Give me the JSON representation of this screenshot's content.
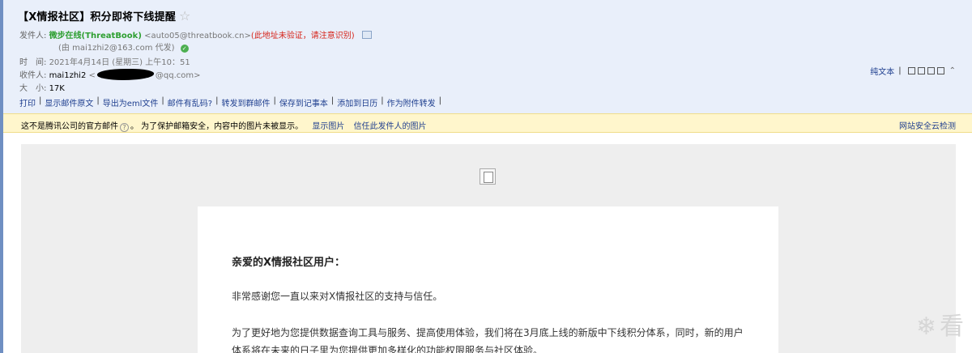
{
  "email": {
    "subject": "【X情报社区】积分即将下线提醒",
    "from_label": "发件人:",
    "from_name": "微步在线(ThreatBook)",
    "from_addr": "<auto05@threatbook.cn>",
    "from_warning": "(此地址未验证，请注意识别)",
    "via": "(由 mai1zhi2@163.com 代发)",
    "time_label": "时　间:",
    "time_value": "2021年4月14日 (星期三) 上午10：51",
    "to_label": "收件人:",
    "to_name": "mai1zhi2",
    "to_addr_start": "<",
    "to_addr_end": "@qq.com>",
    "size_label": "大　小:",
    "size_value": "17K"
  },
  "actions": [
    "打印",
    "显示邮件原文",
    "导出为eml文件",
    "邮件有乱码?",
    "转发到群邮件",
    "保存到记事本",
    "添加到日历",
    "作为附件转发"
  ],
  "right_tools": {
    "plain_text": "纯文本"
  },
  "warning": {
    "text_before": "这不是腾讯公司的官方邮件",
    "text_after": "。 为了保护邮箱安全，内容中的图片未被显示。",
    "show_images": "显示图片",
    "trust_sender": "信任此发件人的图片",
    "cloud_check": "网站安全云检测"
  },
  "body": {
    "greeting": "亲爱的X情报社区用户：",
    "p1": "非常感谢您一直以来对X情报社区的支持与信任。",
    "p2": "为了更好地为您提供数据查询工具与服务、提高使用体验，我们将在3月底上线的新版中下线积分体系，同时，新的用户体系将在未来的日子里为您提供更加多样化的功能权限服务与社区体验。"
  },
  "watermark": "看"
}
